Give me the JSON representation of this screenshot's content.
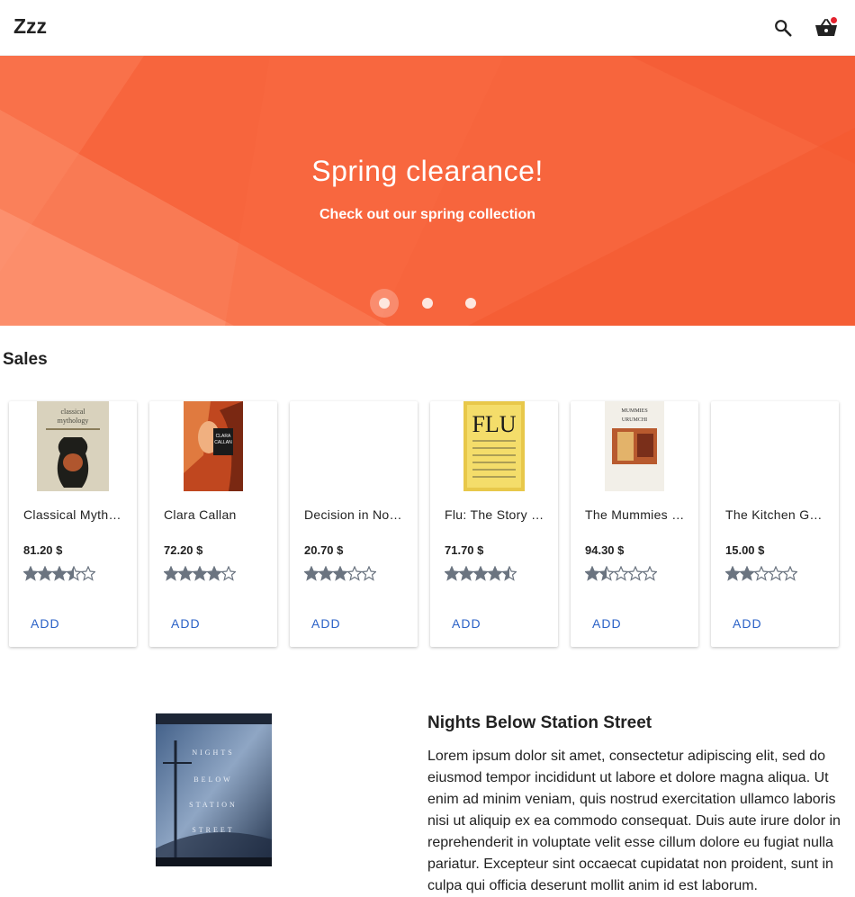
{
  "app": {
    "brand": "Zzz",
    "cart_has_items": true
  },
  "hero": {
    "title": "Spring clearance!",
    "subtitle": "Check out our spring collection",
    "slide_count": 3,
    "active_slide": 1
  },
  "sales": {
    "title": "Sales",
    "products": [
      {
        "name": "Classical Mythology",
        "price": "81.20 $",
        "rating": 3.5,
        "add_label": "ADD",
        "cover": "classical-mythology"
      },
      {
        "name": "Clara Callan",
        "price": "72.20 $",
        "rating": 4.0,
        "add_label": "ADD",
        "cover": "clara-callan"
      },
      {
        "name": "Decision in Normandy",
        "price": "20.70 $",
        "rating": 3.0,
        "add_label": "ADD",
        "cover": "none"
      },
      {
        "name": "Flu: The Story of the Great Influenza Pandemic",
        "price": "71.70 $",
        "rating": 4.5,
        "add_label": "ADD",
        "cover": "flu"
      },
      {
        "name": "The Mummies of Urumchi",
        "price": "94.30 $",
        "rating": 1.5,
        "add_label": "ADD",
        "cover": "mummies"
      },
      {
        "name": "The Kitchen God's Wife",
        "price": "15.00 $",
        "rating": 2.0,
        "add_label": "ADD",
        "cover": "none"
      }
    ]
  },
  "featured": {
    "title": "Nights Below Station Street",
    "description": "Lorem ipsum dolor sit amet, consectetur adipiscing elit, sed do eiusmod tempor incididunt ut labore et dolore magna aliqua. Ut enim ad minim veniam, quis nostrud exercitation ullamco laboris nisi ut aliquip ex ea commodo consequat. Duis aute irure dolor in reprehenderit in voluptate velit esse cillum dolore eu fugiat nulla pariatur. Excepteur sint occaecat cupidatat non proident, sunt in culpa qui officia deserunt mollit anim id est laborum."
  },
  "colors": {
    "accent": "#2b62c7",
    "hero": "#f96a40",
    "badge": "#e3222e",
    "star": "#6b7480"
  }
}
